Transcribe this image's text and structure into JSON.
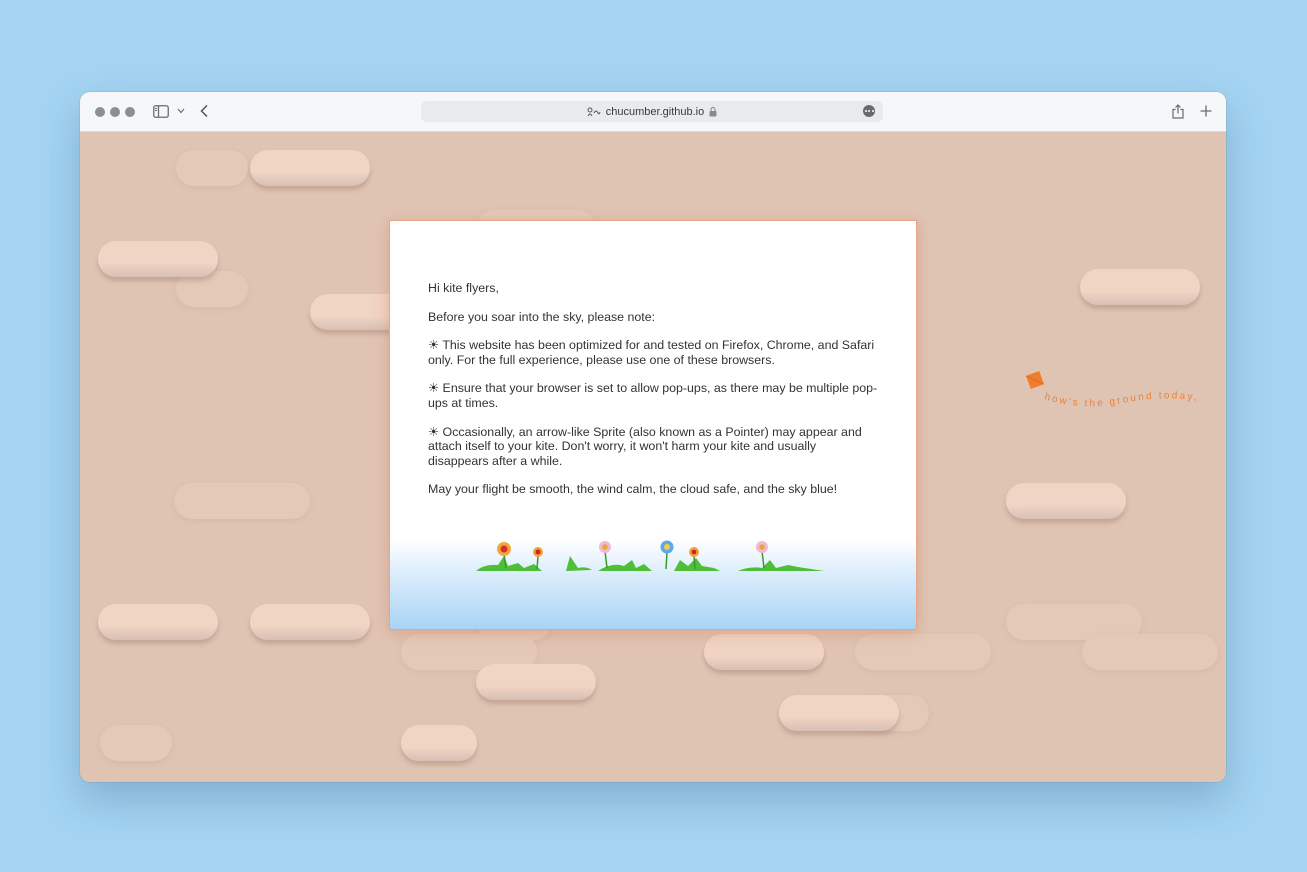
{
  "browser": {
    "url": "chucumber.github.io"
  },
  "dialog": {
    "greeting": "Hi kite flyers,",
    "intro": "Before you soar into the sky, please note:",
    "notes": [
      "☀ This website has been optimized for and tested on Firefox, Chrome, and Safari only. For the full experience, please use one of these browsers.",
      "☀ Ensure that your browser is set to allow pop-ups, as there may be multiple pop-ups at times.",
      "☀ Occasionally, an arrow-like Sprite (also known as a Pointer) may appear and attach itself to your kite. Don't worry, it won't harm your kite and usually disappears after a while."
    ],
    "closing": "May your flight be smooth, the wind calm, the cloud safe, and the sky blue!"
  },
  "side_text": "how's the ground today,",
  "colors": {
    "desktop": "#a4d4f2",
    "page_background": "#e0c4b3",
    "cloud": "#f0d4c4",
    "kite": "#f07c2e",
    "side_text": "#e8823a",
    "dialog_border": "#e8a586"
  },
  "icons": [
    "sidebar-icon",
    "chevron-down-icon",
    "back-arrow-icon",
    "tracking-icon",
    "lock-icon",
    "more-icon",
    "share-icon",
    "new-tab-icon",
    "kite-icon",
    "flower-icon"
  ]
}
